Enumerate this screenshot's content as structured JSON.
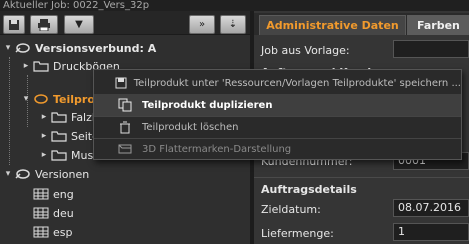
{
  "window": {
    "title": "Aktueller Job: 0022_Vers_32p"
  },
  "toolbar": {
    "btn_save": "save",
    "btn_print": "print",
    "btn_dropdown": "▼",
    "btn_forward": "»",
    "btn_down": "⇣"
  },
  "tree": {
    "versionsverbund": "Versionsverbund: A",
    "druckboegen": "Druckbögen",
    "teilprodukte": "Teilprod",
    "falzbogen": "Falzb",
    "seiten": "Seite",
    "muster": "Must",
    "versionen": "Versionen",
    "version_items": [
      "eng",
      "deu",
      "esp"
    ]
  },
  "right": {
    "tabs": [
      "Administrative Daten",
      "Farben"
    ],
    "job_aus_vorlage": "Job aus Vorlage:",
    "section_auftrag": "Auftrag und Kunde",
    "kundennummer": "Kundennummer:",
    "kundennummer_value": "0001",
    "section_auftragsdetails": "Auftragsdetails",
    "zieldatum": "Zieldatum:",
    "zieldatum_value": "08.07.2016",
    "liefermenge": "Liefermenge:",
    "liefermenge_value": "1"
  },
  "context_menu": {
    "items": [
      "Teilprodukt unter 'Ressourcen/Vorlagen Teilprodukte' speichern ...",
      "Teilprodukt duplizieren",
      "Teilprodukt löschen",
      "3D Flattermarken-Darstellung"
    ]
  },
  "colors": {
    "accent": "#f19a2d",
    "background": "#2c2c2c"
  }
}
